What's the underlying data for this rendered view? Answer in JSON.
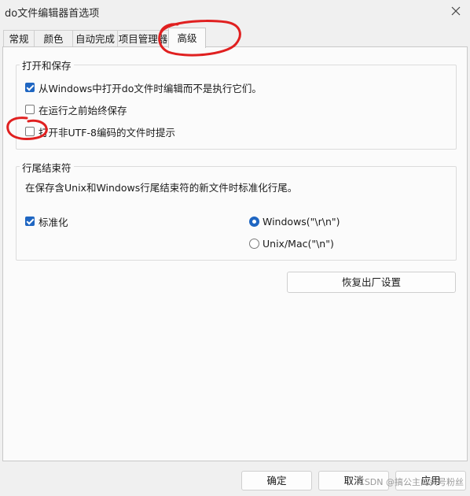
{
  "window": {
    "title": "do文件编辑器首选项"
  },
  "tabs": [
    {
      "label": "常规"
    },
    {
      "label": "颜色"
    },
    {
      "label": "自动完成"
    },
    {
      "label": "项目管理器"
    },
    {
      "label": "高级"
    }
  ],
  "open_save": {
    "title": "打开和保存",
    "options": [
      {
        "label": "从Windows中打开do文件时编辑而不是执行它们。",
        "checked": true
      },
      {
        "label": "在运行之前始终保存",
        "checked": false
      },
      {
        "label": "打开非UTF-8编码的文件时提示",
        "checked": false
      }
    ]
  },
  "line_endings": {
    "title": "行尾结束符",
    "description": "在保存含Unix和Windows行尾结束符的新文件时标准化行尾。",
    "normalize": {
      "label": "标准化",
      "checked": true
    },
    "radios": [
      {
        "label": "Windows(\"\\r\\n\")",
        "selected": true
      },
      {
        "label": "Unix/Mac(\"\\n\")",
        "selected": false
      }
    ]
  },
  "restore_button": {
    "label": "恢复出厂设置"
  },
  "footer": {
    "ok": "确定",
    "cancel": "取消",
    "apply": "应用"
  },
  "watermark": "CSDN @搞公主的头号粉丝",
  "colors": {
    "accent": "#1f66c2",
    "annotation": "#e02020"
  }
}
